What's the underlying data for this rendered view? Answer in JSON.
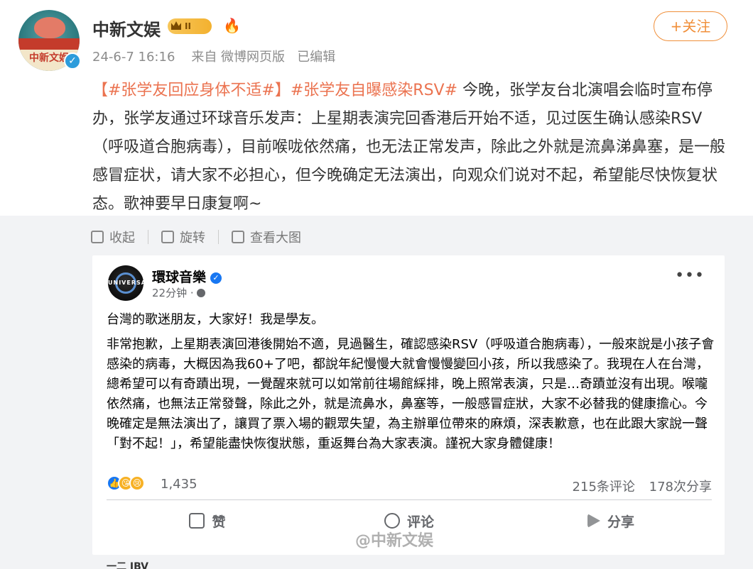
{
  "author": {
    "name": "中新文娱",
    "avatar_text": "中新文娱",
    "member_badge": "II",
    "verified_icon": "verified-check-icon",
    "fire_icon": "fire-icon"
  },
  "post_meta": {
    "time": "24-6-7 16:16",
    "source": "来自 微博网页版",
    "edited": "已编辑"
  },
  "follow_button": "+关注",
  "content": {
    "tag1": "【#张学友回应身体不适#】",
    "tag2": "#张学友自曝感染RSV#",
    "text": " 今晚，张学友台北演唱会临时宣布停办，张学友通过环球音乐发声：上星期表演完回香港后开始不适，见过医生确认感染RSV（呼吸道合胞病毒），目前喉咙依然痛，也无法正常发声，除此之外就是流鼻涕鼻塞，是一般感冒症状，请大家不必担心，但今晚确定无法演出，向观众们说对不起，希望能尽快恢复状态。歌神要早日康复啊~"
  },
  "toolbar": {
    "collapse": "收起",
    "rotate": "旋转",
    "view_large": "查看大图"
  },
  "embedded_post": {
    "page_name": "環球音樂",
    "avatar_text": "UNIVERSAL",
    "time": "22分钟 ·",
    "greeting": "台灣的歌迷朋友，大家好！我是學友。",
    "body": "非常抱歉，上星期表演回港後開始不適，見過醫生，確認感染RSV（呼吸道合胞病毒），一般來說是小孩子會感染的病毒，大概因為我60+了吧，都說年紀慢慢大就會慢慢變回小孩，所以我感染了。我現在人在台灣，總希望可以有奇蹟出現，一覺醒來就可以如常前往場館綵排，晚上照常表演，只是…奇蹟並沒有出現。喉嚨依然痛，也無法正常發聲，除此之外，就是流鼻水，鼻塞等，一般感冒症狀，大家不必替我的健康擔心。今晚確定是無法演出了，讓買了票入場的觀眾失望，為主辦單位帶來的麻煩，深表歉意，也在此跟大家說一聲「對不起！」，希望能盡快恢復狀態，重返舞台為大家表演。謹祝大家身體健康！",
    "reaction_count": "1,435",
    "comments": "215条评论",
    "shares": "178次分享",
    "actions": {
      "like": "赞",
      "comment": "评论",
      "share": "分享"
    },
    "more_icon": "•••"
  },
  "watermark": "@中新文娱",
  "cut_text": "一二 IBV"
}
